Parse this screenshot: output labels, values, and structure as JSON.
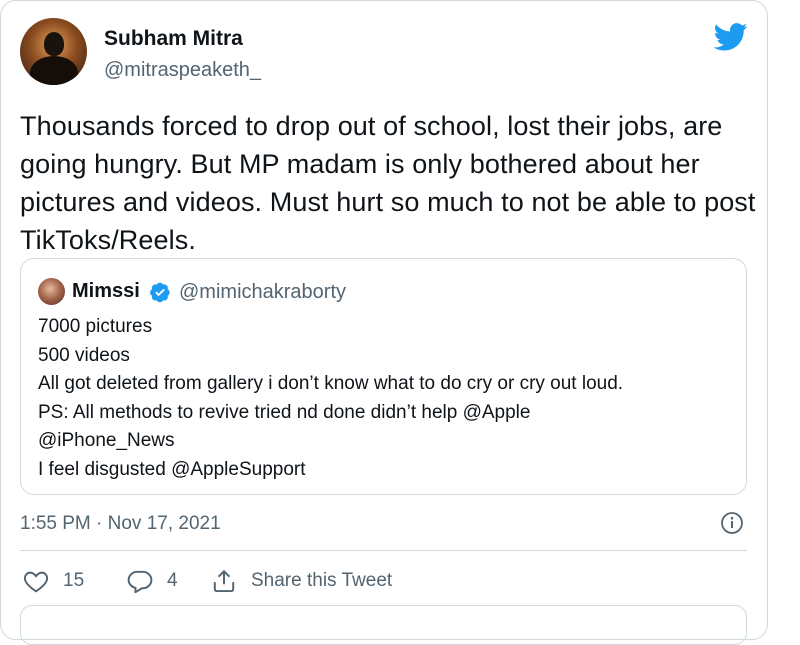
{
  "author": {
    "name": "Subham Mitra",
    "handle": "@mitraspeaketh_"
  },
  "tweet": {
    "text": "Thousands forced to drop out of school, lost their jobs, are going hungry. But MP madam is only bothered about her pictures and videos. Must hurt so much to not be able to post TikToks/Reels."
  },
  "quote": {
    "name": "Mimssi",
    "handle": "@mimichakraborty",
    "lines": [
      "7000 pictures",
      "500 videos",
      "All got deleted from gallery i don’t know what to do cry or cry out loud.",
      "PS: All methods to revive tried nd done didn’t help @Apple",
      "@iPhone_News",
      "I feel disgusted @AppleSupport"
    ]
  },
  "meta": {
    "timestamp": "1:55 PM · Nov 17, 2021"
  },
  "actions": {
    "likes": "15",
    "replies": "4",
    "share_label": "Share this Tweet"
  },
  "colors": {
    "twitter_blue": "#1d9bf0",
    "secondary_text": "#536471",
    "border": "#cfd9de"
  },
  "icons": [
    "twitter-bird-icon",
    "verified-badge-icon",
    "info-icon",
    "heart-icon",
    "reply-icon",
    "share-icon"
  ]
}
